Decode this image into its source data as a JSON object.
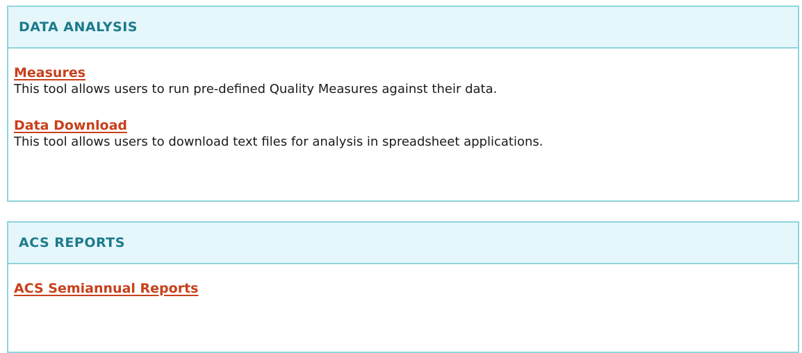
{
  "data_analysis": {
    "title": "DATA ANALYSIS",
    "items": [
      {
        "link": "Measures",
        "description": "This tool allows users to run pre-defined Quality Measures against their data."
      },
      {
        "link": "Data Download",
        "description": "This tool allows users to download text files for analysis in spreadsheet applications."
      }
    ]
  },
  "acs_reports": {
    "title": "ACS REPORTS",
    "items": [
      {
        "link": "ACS Semiannual Reports"
      }
    ]
  },
  "colors": {
    "header_bg": "#e5f7fb",
    "border": "#8fd4dc",
    "title": "#1d7a8c",
    "link": "#c8401b"
  }
}
